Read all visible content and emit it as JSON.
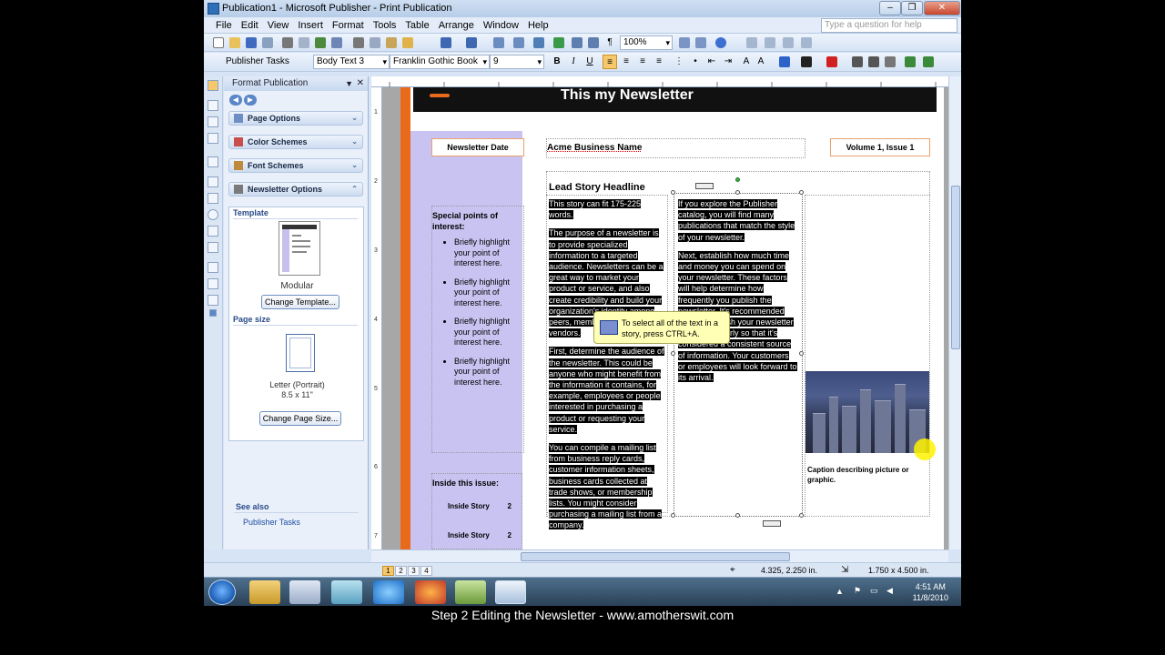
{
  "window": {
    "title": "Publication1 - Microsoft Publisher - Print Publication"
  },
  "menu": {
    "items": [
      "File",
      "Edit",
      "View",
      "Insert",
      "Format",
      "Tools",
      "Table",
      "Arrange",
      "Window",
      "Help"
    ],
    "help_placeholder": "Type a question for help"
  },
  "standard_toolbar": {
    "zoom": "100%"
  },
  "format_toolbar": {
    "publisher_tasks": "Publisher Tasks",
    "style": "Body Text 3",
    "font": "Franklin Gothic Book",
    "size": "9"
  },
  "task_pane": {
    "title": "Format Publication",
    "sections": [
      "Page Options",
      "Color Schemes",
      "Font Schemes",
      "Newsletter Options"
    ],
    "template_label": "Template",
    "template_name": "Modular",
    "change_template": "Change Template...",
    "page_size_label": "Page size",
    "page_size_name": "Letter (Portrait)",
    "page_size_dims": "8.5 x 11\"",
    "change_page_size": "Change Page Size...",
    "see_also": "See also",
    "see_also_link": "Publisher Tasks"
  },
  "newsletter": {
    "banner_title": "This my Newsletter",
    "date": "Newsletter Date",
    "business_name": "Acme Business Name",
    "volume": "Volume 1, Issue 1",
    "headline": "Lead Story Headline",
    "col1": [
      "This story can fit 175-225 words.",
      "The purpose of a newsletter is to provide specialized information to a targeted audience. Newsletters can be a great way to market your product or service, and also create credibility and build your organization's identity among peers, members, employees, or vendors.",
      "First, determine the audience of the newsletter. This could be anyone who might benefit from the information it contains, for example, employees or people interested in purchasing a product or requesting your service.",
      "You can compile a mailing list from business reply cards, customer information sheets, business cards collected at trade shows, or membership lists. You might consider purchasing a mailing list from a company."
    ],
    "col2": [
      "If you explore the Publisher catalog, you will find many publications that match the style of your newsletter.",
      "Next, establish how much time and money you can spend on your newsletter. These factors will help determine how frequently you publish the newsletter. It's recommended that you publish your newsletter at least quarterly so that it's considered a consistent source of information. Your customers or employees will look forward to its arrival."
    ],
    "specials_heading": "Special points of interest:",
    "specials": [
      "Briefly highlight your point of interest here.",
      "Briefly highlight your point of interest here.",
      "Briefly highlight your point of interest here.",
      "Briefly highlight your point of interest here."
    ],
    "inside_heading": "Inside this issue:",
    "inside_items": [
      {
        "label": "Inside Story",
        "page": "2"
      },
      {
        "label": "Inside Story",
        "page": "2"
      }
    ],
    "photo_caption": "Caption describing picture or graphic."
  },
  "tooltip": {
    "text": "To select all of the text in a story, press CTRL+A."
  },
  "status": {
    "pages": [
      "1",
      "2",
      "3",
      "4"
    ],
    "position": "4.325, 2.250 in.",
    "size": "1.750 x 4.500 in."
  },
  "ruler": {
    "vertical": [
      "1",
      "2",
      "3",
      "4",
      "5",
      "6",
      "7"
    ]
  },
  "tray": {
    "time": "4:51 AM",
    "date": "11/8/2010"
  },
  "video_caption": "Step 2 Editing the Newsletter - www.amotherswit.com"
}
